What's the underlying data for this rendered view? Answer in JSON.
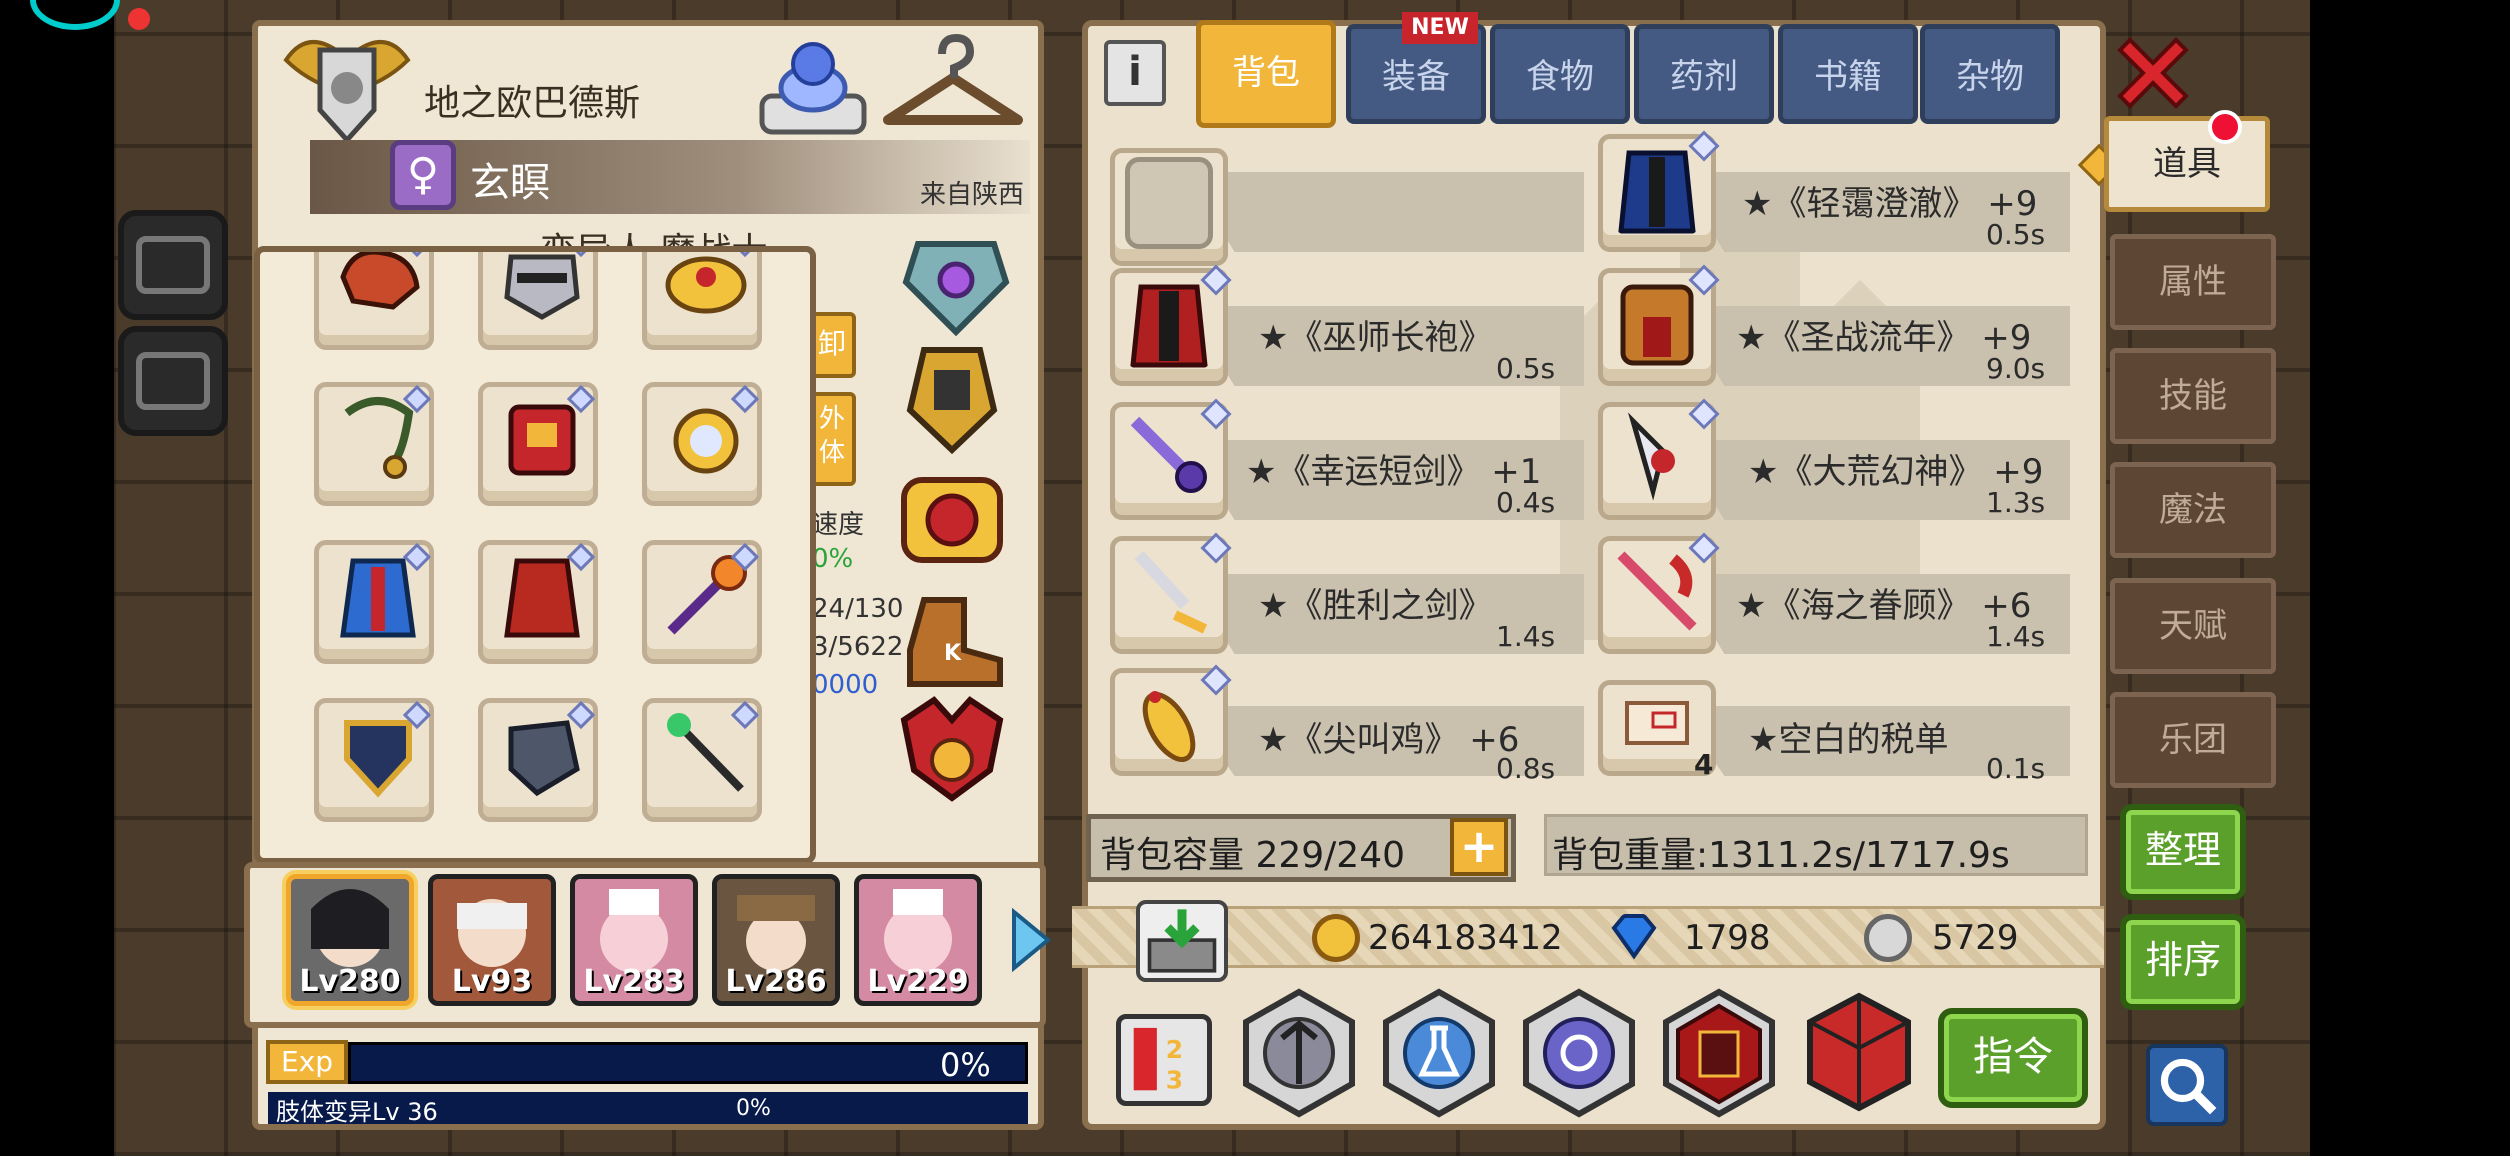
{
  "character": {
    "title": "地之欧巴德斯",
    "gender_symbol": "♀",
    "name": "玄瞑",
    "origin": "来自陕西",
    "class_partial": "变异人 魔战士",
    "side_buttons": [
      "卸",
      "外\n体"
    ],
    "side_partials": [
      "速度",
      "0%",
      "24/130",
      "3/5622",
      "0000"
    ]
  },
  "party": {
    "members": [
      {
        "level": "Lv280",
        "selected": true
      },
      {
        "level": "Lv93",
        "selected": false
      },
      {
        "level": "Lv283",
        "selected": false
      },
      {
        "level": "Lv286",
        "selected": false
      },
      {
        "level": "Lv229",
        "selected": false
      }
    ]
  },
  "exp": {
    "label": "Exp",
    "percent_text": "0%",
    "value": 0,
    "limb_label": "肢体变异Lv 36",
    "limb_percent_text": "0%"
  },
  "inventory": {
    "info_label": "i",
    "tabs": [
      {
        "label": "背包",
        "active": true
      },
      {
        "label": "装备",
        "active": false,
        "badge": "NEW"
      },
      {
        "label": "食物",
        "active": false
      },
      {
        "label": "药剂",
        "active": false
      },
      {
        "label": "书籍",
        "active": false
      },
      {
        "label": "杂物",
        "active": false
      }
    ],
    "items": [
      {
        "name": "",
        "weight": ""
      },
      {
        "name": "★《轻霭澄澈》 +9",
        "weight": "0.5s"
      },
      {
        "name": "★《巫师长袍》",
        "weight": "0.5s"
      },
      {
        "name": "★《圣战流年》 +9",
        "weight": "9.0s"
      },
      {
        "name": "★《幸运短剑》 +1",
        "weight": "0.4s"
      },
      {
        "name": "★《大荒幻神》 +9",
        "weight": "1.3s"
      },
      {
        "name": "★《胜利之剑》",
        "weight": "1.4s"
      },
      {
        "name": "★《海之眷顾》 +6",
        "weight": "1.4s"
      },
      {
        "name": "★《尖叫鸡》 +6",
        "weight": "0.8s"
      },
      {
        "name": "★空白的税单",
        "weight": "0.1s",
        "count": "4"
      }
    ],
    "capacity_text": "背包容量 229/240",
    "capacity_plus": "+",
    "weight_text": "背包重量:1311.2s/1717.9s",
    "currency": {
      "gold": "264183412",
      "diamond": "1798",
      "silver": "5729"
    },
    "command_label": "指令"
  },
  "right_tabs": [
    {
      "label": "道具",
      "active": true
    },
    {
      "label": "属性",
      "active": false
    },
    {
      "label": "技能",
      "active": false
    },
    {
      "label": "魔法",
      "active": false
    },
    {
      "label": "天赋",
      "active": false
    },
    {
      "label": "乐团",
      "active": false
    }
  ],
  "actions": {
    "organize": "整理",
    "sort": "排序"
  },
  "colors": {
    "accent_gold": "#f2b73a",
    "tab_blue": "#445a82",
    "action_green": "#5aa02a",
    "close_red": "#d8262c"
  }
}
